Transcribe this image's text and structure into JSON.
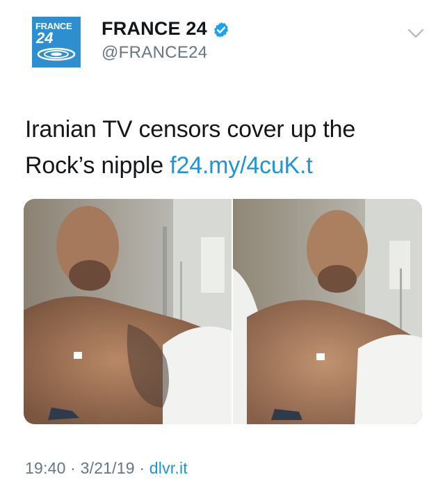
{
  "avatar": {
    "brand_top": "FRANCE",
    "brand_num": "24",
    "icon": "france24-logo-icon"
  },
  "user": {
    "display_name": "FRANCE 24",
    "handle": "@FRANCE24",
    "verified_icon": "verified-badge-icon"
  },
  "menu": {
    "icon": "chevron-down-icon"
  },
  "tweet": {
    "text": "Iranian TV censors cover up the Rock’s nipple ",
    "link": "f24.my/4cuK.t"
  },
  "media": {
    "left_photo": "original-hospital-photo",
    "right_photo": "censored-hospital-photo"
  },
  "meta": {
    "time": "19:40",
    "sep1": " · ",
    "date": "3/21/19",
    "sep2": " · ",
    "source": "dlvr.it"
  },
  "colors": {
    "link": "#1b95e0",
    "muted": "#657786",
    "brand": "#2d8fd0"
  }
}
